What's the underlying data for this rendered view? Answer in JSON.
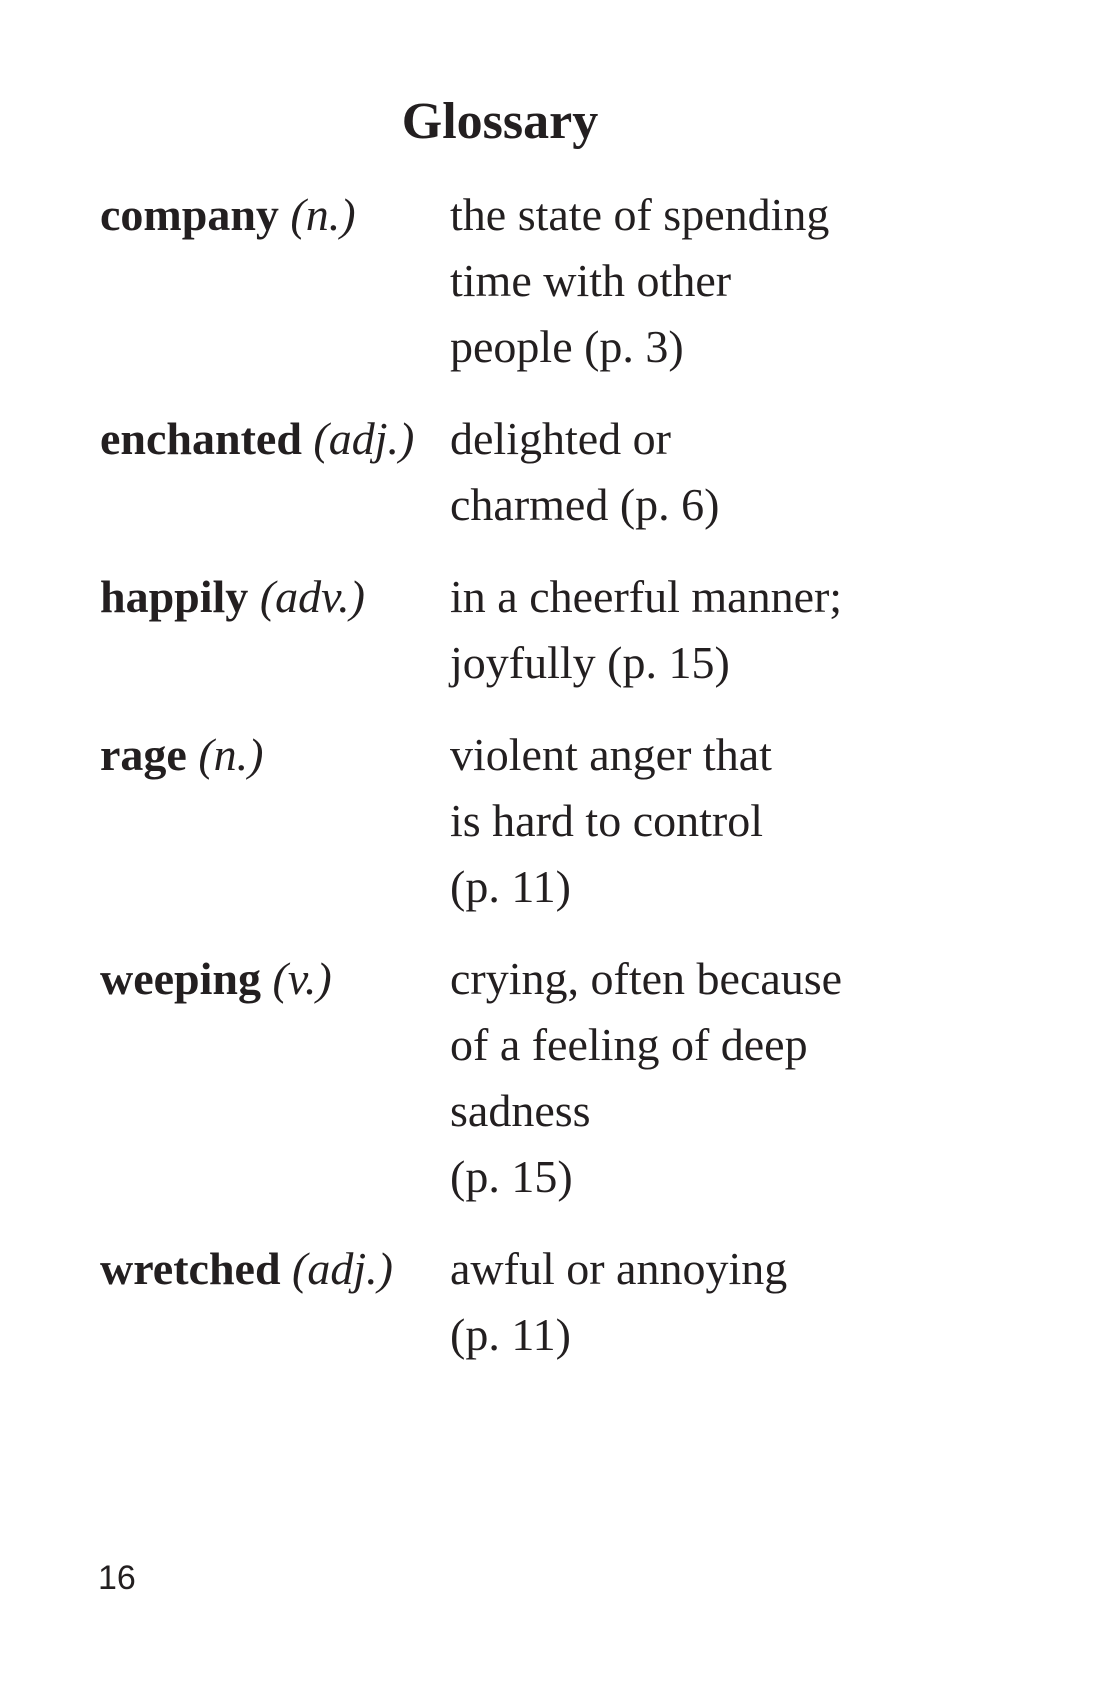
{
  "page": {
    "title": "Glossary",
    "page_number": "16"
  },
  "entries": [
    {
      "term": "company",
      "pos": "(n.)",
      "definition_lines": [
        "the state of spending",
        "time with other",
        "people (p. 3)"
      ]
    },
    {
      "term": "enchanted",
      "pos": "(adj.)",
      "definition_lines": [
        "delighted or",
        "charmed (p. 6)"
      ]
    },
    {
      "term": "happily",
      "pos": "(adv.)",
      "definition_lines": [
        "in a cheerful manner;",
        "joyfully (p. 15)"
      ]
    },
    {
      "term": "rage",
      "pos": "(n.)",
      "definition_lines": [
        "violent anger that",
        "is hard to control",
        "(p. 11)"
      ]
    },
    {
      "term": "weeping",
      "pos": "(v.)",
      "definition_lines": [
        "crying, often because",
        "of a feeling of deep",
        "sadness",
        "(p. 15)"
      ]
    },
    {
      "term": "wretched",
      "pos": "(adj.)",
      "definition_lines": [
        "awful or annoying",
        "(p. 11)"
      ]
    }
  ]
}
